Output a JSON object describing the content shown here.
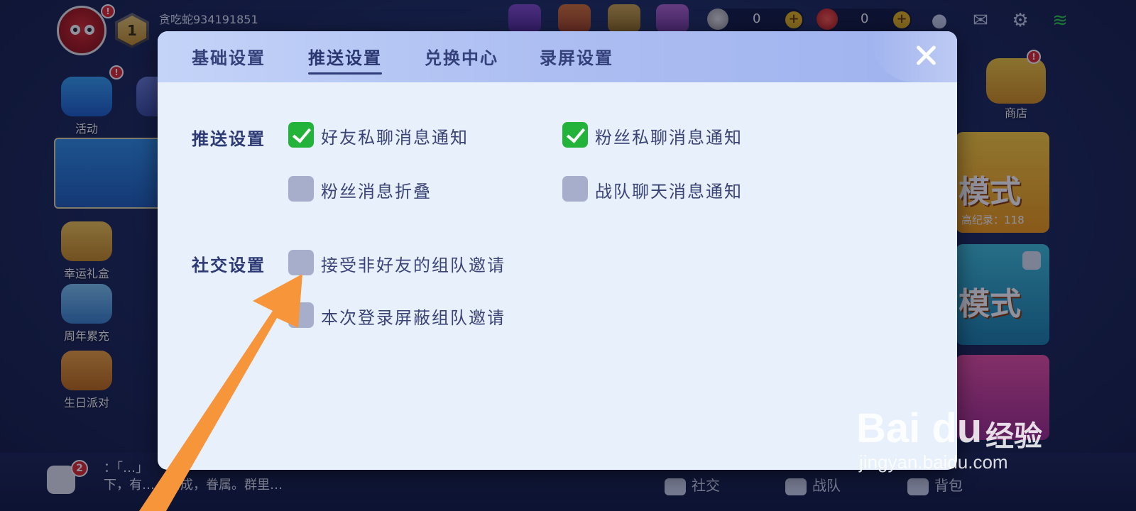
{
  "top": {
    "username": "贪吃蛇934191851",
    "level": "1",
    "notif_badge": "!",
    "currency1": "0",
    "currency2": "0",
    "plus": "+"
  },
  "left_menu": [
    {
      "label": "活动"
    },
    {
      "label": "幸运礼盒"
    },
    {
      "label": "周年累充"
    },
    {
      "label": "生日派对"
    }
  ],
  "right": {
    "shop_label": "商店",
    "mode1_title": "模式",
    "mode1_sub": "高纪录：118",
    "mode2_title": "模式"
  },
  "dialog": {
    "tabs": [
      "基础设置",
      "推送设置",
      "兑换中心",
      "录屏设置"
    ],
    "active_tab": "推送设置",
    "push_section_label": "推送设置",
    "social_section_label": "社交设置",
    "options": {
      "friend_chat": {
        "label": "好友私聊消息通知",
        "checked": true
      },
      "fan_chat": {
        "label": "粉丝私聊消息通知",
        "checked": true
      },
      "fan_fold": {
        "label": "粉丝消息折叠",
        "checked": false
      },
      "team_chat": {
        "label": "战队聊天消息通知",
        "checked": false
      },
      "accept_invite": {
        "label": "接受非好友的组队邀请",
        "checked": false
      },
      "block_invite": {
        "label": "本次登录屏蔽组队邀请",
        "checked": false
      }
    }
  },
  "bottom": {
    "chat_badge": "2",
    "ticker_line1": "：「…」",
    "ticker_line2": "下，有…，终成，眷属。群里…",
    "nav": [
      "社交",
      "战队",
      "背包"
    ]
  },
  "watermark": {
    "brand": "Bai du",
    "cn": "经验",
    "url": "jingyan.baidu.com"
  },
  "colors": {
    "checkbox_on": "#23b33a",
    "checkbox_off": "#a6aecb",
    "arrow": "#f6953a"
  }
}
